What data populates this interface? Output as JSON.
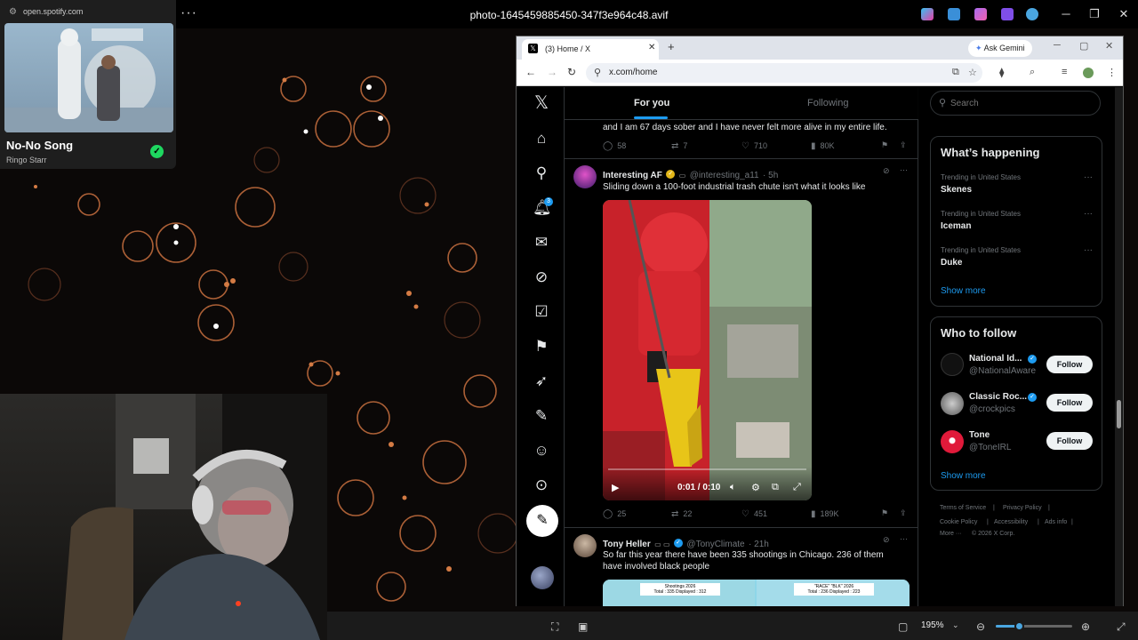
{
  "viewer": {
    "title": "photo-1645459885450-347f3e964c48.avif",
    "more": "···",
    "zoom": "195%",
    "zoom_level": 0.3
  },
  "spotify": {
    "url": "open.spotify.com",
    "song": "No-No Song",
    "artist": "Ringo Starr"
  },
  "browser": {
    "tab_title": "(3) Home / X",
    "tab_close": "✕",
    "new_tab": "+",
    "ask_gemini": "Ask Gemini",
    "url": "x.com/home"
  },
  "x": {
    "tabs": {
      "for_you": "For you",
      "following": "Following"
    },
    "notif_count": "3",
    "tweets": [
      {
        "text": "and I am 67 days sober and I have never felt more alive in my entire life.",
        "replies": "58",
        "reposts": "7",
        "likes": "710",
        "views": "80K"
      },
      {
        "name": "Interesting AF",
        "handle": "@interesting_a11",
        "time": "· 5h",
        "text": "Sliding down a 100-foot industrial trash chute isn't what it looks like",
        "video_time": "0:01 / 0:10",
        "replies": "25",
        "reposts": "22",
        "likes": "451",
        "views": "189K"
      },
      {
        "name": "Tony Heller",
        "handle": "@TonyClimate",
        "time": "· 21h",
        "text_1": "So far this year there have been 335 shootings in Chicago.  236 of them",
        "text_2": "have involved black people",
        "map_1_title": "Shootings 2026",
        "map_1_sub": "Total : 335 Displayed : 312",
        "map_2_title": "\"RACE\" \"BLK\" 2026",
        "map_2_sub": "Total : 236 Displayed : 223"
      }
    ],
    "search_placeholder": "Search",
    "whats_happening": {
      "title": "What’s happening",
      "trends": [
        {
          "meta": "Trending in United States",
          "name": "Skenes"
        },
        {
          "meta": "Trending in United States",
          "name": "Iceman"
        },
        {
          "meta": "Trending in United States",
          "name": "Duke"
        }
      ],
      "show_more": "Show more"
    },
    "who_to_follow": {
      "title": "Who to follow",
      "accounts": [
        {
          "name": "National Id...",
          "handle": "@NationalAware",
          "button": "Follow"
        },
        {
          "name": "Classic Roc...",
          "handle": "@crockpics",
          "button": "Follow"
        },
        {
          "name": "Tone",
          "handle": "@ToneIRL",
          "button": "Follow"
        }
      ],
      "show_more": "Show more"
    },
    "footer": {
      "terms": "Terms of Service",
      "privacy": "Privacy Policy",
      "cookie": "Cookie Policy",
      "accessibility": "Accessibility",
      "ads": "Ads info",
      "more": "More ···",
      "copyright": "© 2026 X Corp."
    }
  }
}
